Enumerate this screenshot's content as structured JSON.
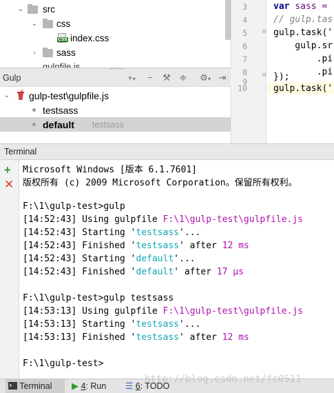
{
  "project_tree": {
    "items": [
      {
        "label": "src"
      },
      {
        "label": "css"
      },
      {
        "label": "index.css"
      },
      {
        "label": "sass"
      },
      {
        "label": "gulpfile.js"
      }
    ]
  },
  "editor": {
    "line_numbers": [
      "3",
      "4",
      "5",
      "6",
      "7",
      "8",
      "9",
      "10"
    ],
    "lines": {
      "l3_kw": "var",
      "l3_rest": " sass = ",
      "l4": "// gulp.tas",
      "l5": "gulp.task('",
      "l6": "    gulp.sr",
      "l7": "        .pi",
      "l8": "        .pi",
      "l9": "});",
      "l10": "gulp.task('"
    }
  },
  "gulp_panel": {
    "title": "Gulp",
    "file": "gulp-test\\gulpfile.js",
    "tasks": [
      {
        "name": "testsass",
        "hint": ""
      },
      {
        "name": "default",
        "hint": "testsass"
      }
    ]
  },
  "terminal": {
    "title": "Terminal",
    "header1": "Microsoft Windows [版本 6.1.7601]",
    "header2": "版权所有 (c) 2009 Microsoft Corporation。保留所有权利。",
    "prompt1": "F:\\1\\gulp-test>gulp",
    "run1": [
      {
        "ts": "[14:52:43]",
        "pre": " Using gulpfile ",
        "hl": "F:\\1\\gulp-test\\gulpfile.js",
        "post": "",
        "num": ""
      },
      {
        "ts": "[14:52:43]",
        "pre": " Starting '",
        "hl": "testsass",
        "post": "'...",
        "num": ""
      },
      {
        "ts": "[14:52:43]",
        "pre": " Finished '",
        "hl": "testsass",
        "post": "' after ",
        "num": "12 ms"
      },
      {
        "ts": "[14:52:43]",
        "pre": " Starting '",
        "hl": "default",
        "post": "'...",
        "num": ""
      },
      {
        "ts": "[14:52:43]",
        "pre": " Finished '",
        "hl": "default",
        "post": "' after ",
        "num": "17 μs"
      }
    ],
    "prompt2": "F:\\1\\gulp-test>gulp testsass",
    "run2": [
      {
        "ts": "[14:53:13]",
        "pre": " Using gulpfile ",
        "hl": "F:\\1\\gulp-test\\gulpfile.js",
        "post": "",
        "num": ""
      },
      {
        "ts": "[14:53:13]",
        "pre": " Starting '",
        "hl": "testsass",
        "post": "'...",
        "num": ""
      },
      {
        "ts": "[14:53:13]",
        "pre": " Finished '",
        "hl": "testsass",
        "post": "' after ",
        "num": "12 ms"
      }
    ],
    "prompt3": "F:\\1\\gulp-test>"
  },
  "bottom_bar": {
    "terminal": "Terminal",
    "run_num": "4",
    "run_label": ": Run",
    "todo_num": "6",
    "todo_label": ": TODO"
  },
  "watermark": "http://blog.csdn.net/fc0511",
  "colors": {
    "accent_cyan": "#11a8b5",
    "accent_magenta": "#b00fb0",
    "add_green": "#2e9b2e",
    "close_red": "#d93a3a"
  },
  "icons": {
    "add": "plus-icon",
    "close": "close-icon",
    "run": "play-icon",
    "todo": "todo-icon",
    "gulp": "gulp-cup-icon"
  }
}
